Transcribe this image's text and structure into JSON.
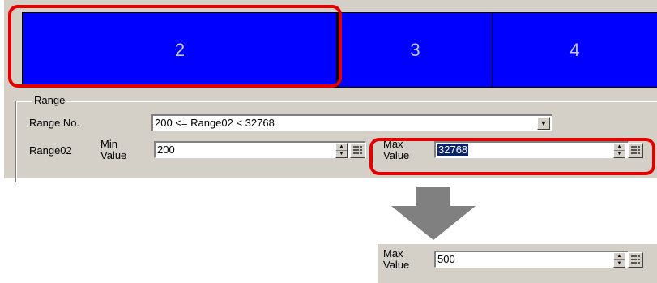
{
  "segments": [
    {
      "label": "2"
    },
    {
      "label": "3"
    },
    {
      "label": "4"
    }
  ],
  "range": {
    "group_title": "Range",
    "range_no_label": "Range No.",
    "range_no_value": "200 <= Range02 < 32768",
    "row_label": "Range02",
    "min_label_line1": "Min",
    "min_label_line2": "Value",
    "min_value": "200",
    "max_label_line1": "Max",
    "max_label_line2": "Value",
    "max_value": "32768"
  },
  "after": {
    "max_label_line1": "Max",
    "max_label_line2": "Value",
    "max_value": "500"
  },
  "icons": {
    "combo": "dropdown-arrow-icon",
    "spin": "spin-updown-icon",
    "keypad": "keypad-icon",
    "transition": "down-arrow-icon"
  },
  "colors": {
    "segment_fill": "#0000ff",
    "highlight": "#e20000",
    "selection": "#0a246a",
    "panel": "#d4d0c8"
  }
}
